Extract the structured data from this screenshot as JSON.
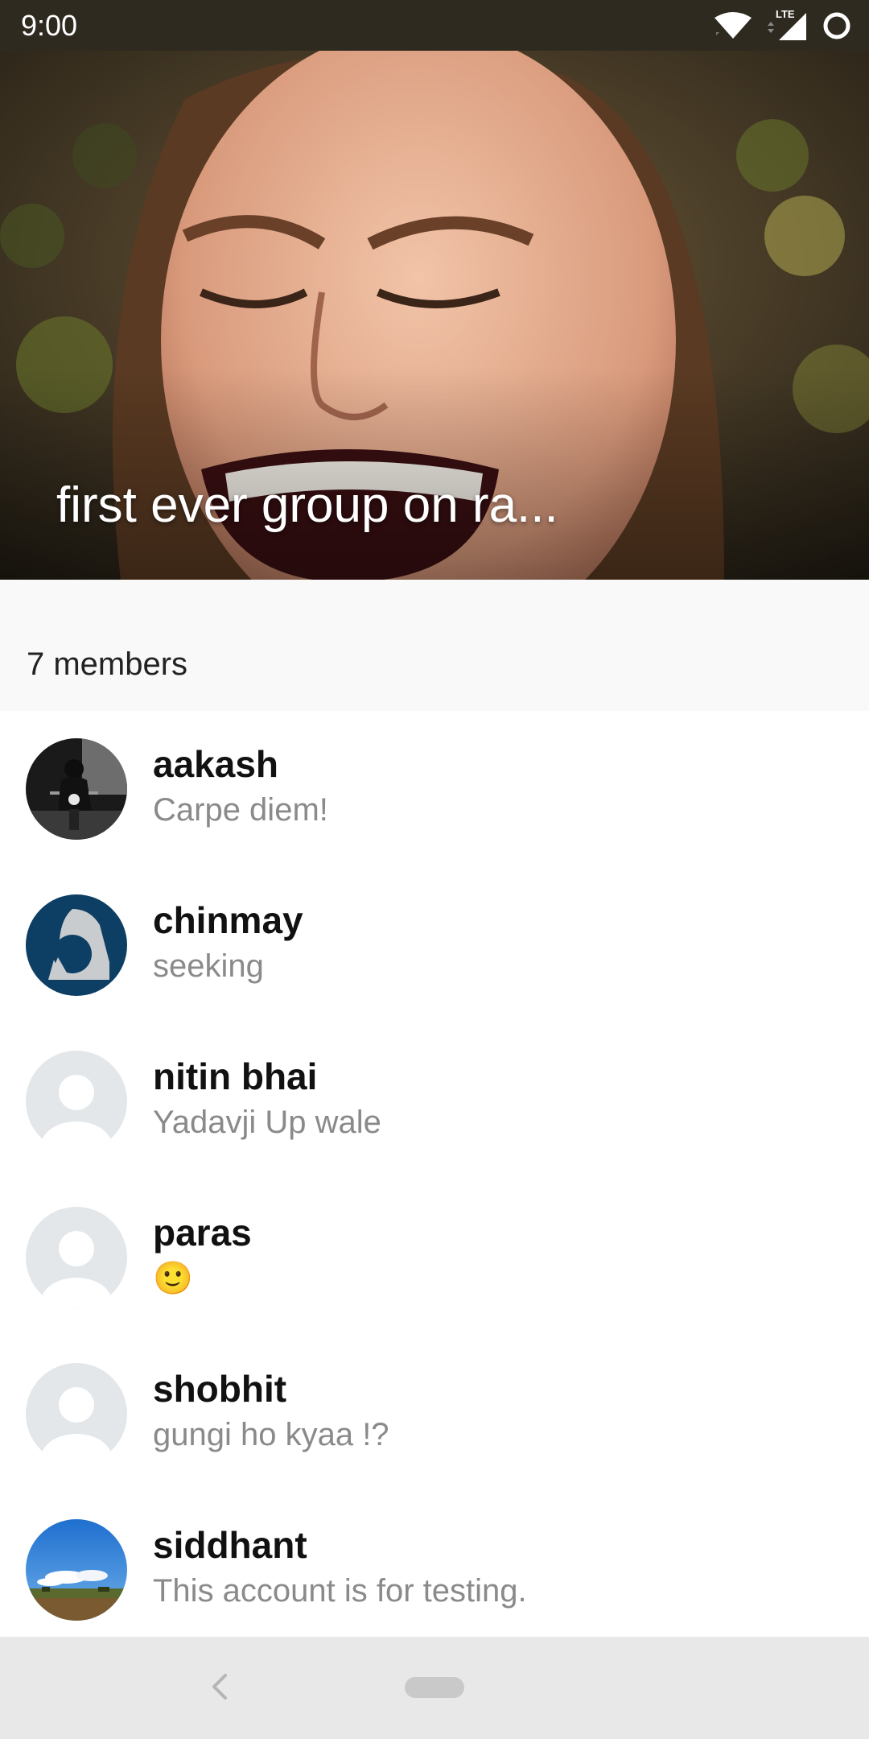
{
  "status_bar": {
    "time": "9:00",
    "network_label": "LTE",
    "icons": [
      "wifi-icon",
      "cell-signal-icon",
      "battery-icon"
    ]
  },
  "group": {
    "title": "first ever group on ra..."
  },
  "members_section": {
    "count_label": "7 members"
  },
  "members": [
    {
      "name": "aakash",
      "status": "Carpe diem!",
      "avatar": "motorcycle-photo"
    },
    {
      "name": "chinmay",
      "status": "seeking",
      "avatar": "logo-avatar"
    },
    {
      "name": "nitin bhai",
      "status": "Yadavji Up wale",
      "avatar": "default-avatar"
    },
    {
      "name": "paras",
      "status": "🙂",
      "avatar": "default-avatar"
    },
    {
      "name": "shobhit",
      "status": "gungi ho kyaa !?",
      "avatar": "default-avatar"
    },
    {
      "name": "siddhant",
      "status": "This account is for testing.",
      "avatar": "landscape-photo"
    }
  ],
  "nav_bar": {
    "icons": [
      "back-chevron-icon",
      "home-pill-icon"
    ]
  },
  "colors": {
    "status_bar_bg": "#2f2a1f",
    "members_header_bg": "#f9f9f9",
    "nav_bar_bg": "#e8e8e8",
    "name_text": "#111111",
    "status_text": "#8a8a8a",
    "default_avatar_bg": "#e3e7ea",
    "chinmay_avatar_bg": "#0d3e63"
  }
}
